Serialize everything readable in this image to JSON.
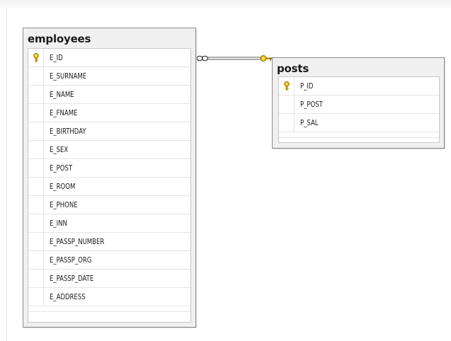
{
  "employees": {
    "title": "employees",
    "columns": [
      {
        "name": "E_ID",
        "pk": true
      },
      {
        "name": "E_SURNAME",
        "pk": false
      },
      {
        "name": "E_NAME",
        "pk": false
      },
      {
        "name": "E_FNAME",
        "pk": false
      },
      {
        "name": "E_BIRTHDAY",
        "pk": false
      },
      {
        "name": "E_SEX",
        "pk": false
      },
      {
        "name": "E_POST",
        "pk": false
      },
      {
        "name": "E_ROOM",
        "pk": false
      },
      {
        "name": "E_PHONE",
        "pk": false
      },
      {
        "name": "E_INN",
        "pk": false
      },
      {
        "name": "E_PASSP_NUMBER",
        "pk": false
      },
      {
        "name": "E_PASSP_ORG",
        "pk": false
      },
      {
        "name": "E_PASSP_DATE",
        "pk": false
      },
      {
        "name": "E_ADDRESS",
        "pk": false
      }
    ]
  },
  "posts": {
    "title": "posts",
    "columns": [
      {
        "name": "P_ID",
        "pk": true
      },
      {
        "name": "P_POST",
        "pk": false
      },
      {
        "name": "P_SAL",
        "pk": false
      }
    ]
  },
  "relationship": {
    "from_table": "employees",
    "to_table": "posts",
    "from_end": "many",
    "to_end": "one"
  },
  "colors": {
    "key_gold": "#e8b400",
    "border": "#8c8c8c",
    "table_bg": "#f0f0f0"
  }
}
